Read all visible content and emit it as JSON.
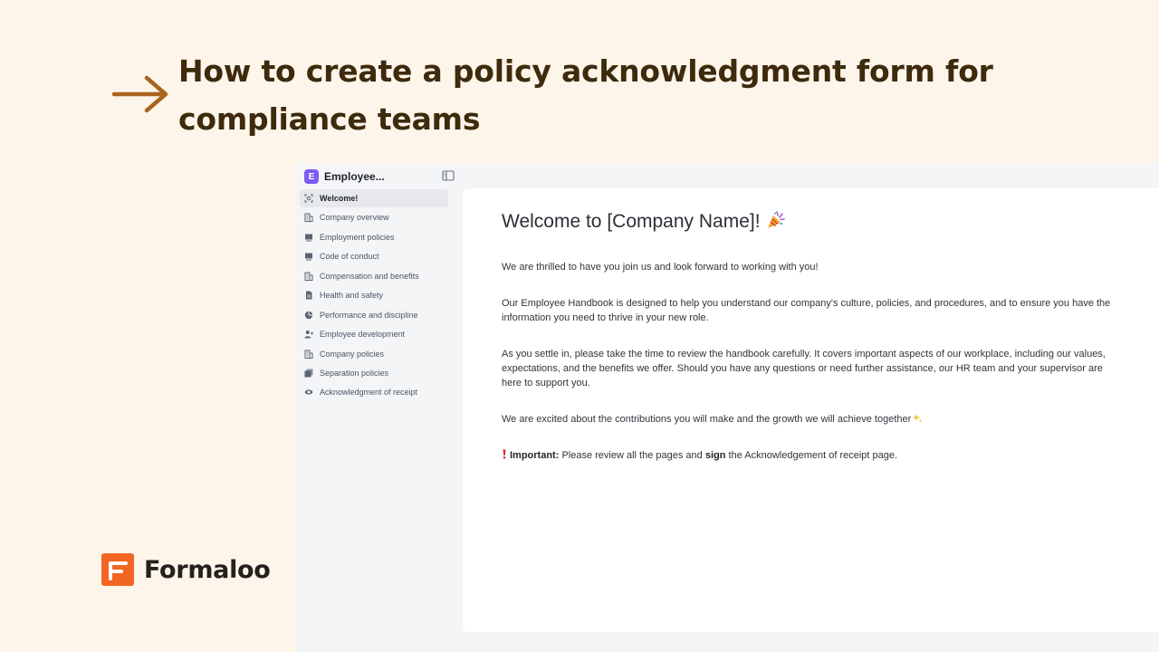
{
  "article": {
    "title": "How to create a policy acknowledgment form for compliance teams"
  },
  "brand": {
    "name": "Formaloo",
    "accent": "#f26522"
  },
  "app": {
    "workspace": {
      "initial": "E",
      "title": "Employee...",
      "avatar_color": "#7c5cf2"
    },
    "nav_items": [
      {
        "label": "Welcome!",
        "icon": "welcome-icon",
        "active": true
      },
      {
        "label": "Company overview",
        "icon": "building-icon"
      },
      {
        "label": "Employment policies",
        "icon": "monitor-icon"
      },
      {
        "label": "Code of conduct",
        "icon": "monitor-icon"
      },
      {
        "label": "Compensation and benefits",
        "icon": "building-icon"
      },
      {
        "label": "Health and safety",
        "icon": "document-icon"
      },
      {
        "label": "Performance and discipline",
        "icon": "pie-chart-icon"
      },
      {
        "label": "Employee development",
        "icon": "person-add-icon"
      },
      {
        "label": "Company policies",
        "icon": "building-icon"
      },
      {
        "label": "Separation policies",
        "icon": "stack-icon"
      },
      {
        "label": "Acknowledgment of receipt",
        "icon": "eye-icon"
      }
    ],
    "page": {
      "title": "Welcome to [Company Name]!",
      "intro": "We are thrilled to have you join us and look forward to working with you!",
      "handbook": "Our Employee Handbook is designed to help you understand our company's culture, policies, and procedures, and to ensure you have the information you need to thrive in your new role.",
      "settle": "As you settle in, please take the time to review the handbook carefully. It covers important aspects of our workplace, including our values, expectations, and the benefits we offer. Should you have any questions or need further assistance, our HR team and your supervisor are here to support you.",
      "excited": "We are excited about the contributions you will make and the growth we will achieve together",
      "important_label": "Important:",
      "important_pre": "Please review all the pages and",
      "important_sign": "sign",
      "important_post": "the Acknowledgement of receipt page."
    }
  }
}
